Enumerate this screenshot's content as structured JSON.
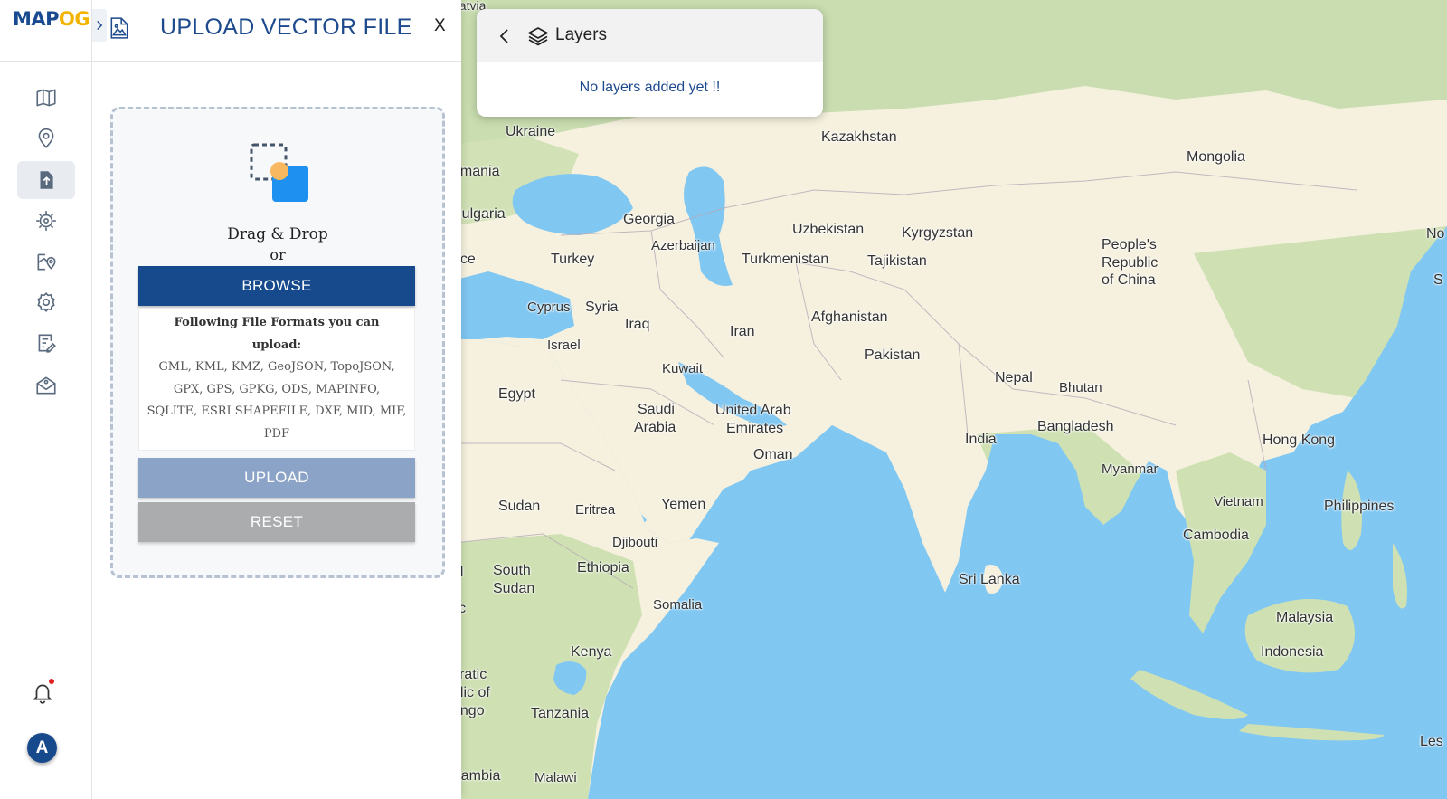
{
  "app": {
    "logo_main": "MAP",
    "logo_og": "OG"
  },
  "rail": {
    "items": [
      {
        "icon": "map-icon"
      },
      {
        "icon": "location-pin-icon"
      },
      {
        "icon": "upload-file-icon",
        "active": true
      },
      {
        "icon": "gear-process-icon"
      },
      {
        "icon": "map-pin-icon"
      },
      {
        "icon": "settings-gear-icon"
      },
      {
        "icon": "checklist-edit-icon"
      },
      {
        "icon": "map-mail-icon"
      }
    ],
    "avatar_letter": "A"
  },
  "panel": {
    "title": "UPLOAD VECTOR FILE",
    "close_label": "X",
    "drag_drop": "Drag & Drop",
    "or": "or",
    "browse_label": "BROWSE",
    "formats_title": "Following File Formats you can upload:",
    "formats_list": "GML, KML, KMZ, GeoJSON, TopoJSON, GPX, GPS, GPKG, ODS, MAPINFO, SQLITE, ESRI SHAPEFILE, DXF, MID, MIF, PDF",
    "upload_label": "UPLOAD",
    "reset_label": "RESET"
  },
  "layers": {
    "title": "Layers",
    "empty_message": "No layers added yet !!"
  },
  "map": {
    "labels": [
      "Latvia",
      "Ukraine",
      "omania",
      "Bulgaria",
      "ece",
      "Kazakhstan",
      "Mongolia",
      "Georgia",
      "Azerbaijan",
      "Uzbekistan",
      "Kyrgyzstan",
      "Turkey",
      "Turkmenistan",
      "Tajikistan",
      "People's",
      "Republic",
      "of China",
      "No",
      "Cyprus",
      "Syria",
      "Iraq",
      "Iran",
      "Afghanistan",
      "Israel",
      "Pakistan",
      "Kuwait",
      "Egypt",
      "Nepal",
      "Bhutan",
      "Saudi",
      "Arabia",
      "United Arab",
      "Emirates",
      "India",
      "Bangladesh",
      "Hong Kong",
      "Oman",
      "Myanmar",
      "Sudan",
      "Eritrea",
      "Yemen",
      "Vietnam",
      "Philippines",
      "Cambodia",
      "Djibouti",
      "South",
      "Sudan",
      "Ethiopia",
      "Sri Lanka",
      "Somalia",
      "Malaysia",
      "Kenya",
      "Indonesia",
      "cratic",
      "blic of",
      "ongo",
      "Tanzania",
      "Zambia",
      "Malawi",
      "al",
      "n",
      "lic",
      "S",
      "Les"
    ]
  }
}
